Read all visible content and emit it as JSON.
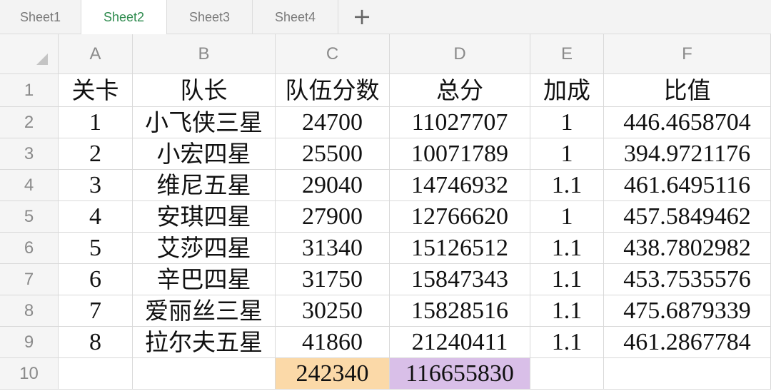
{
  "sheet_tabs": [
    {
      "label": "Sheet1",
      "active": false
    },
    {
      "label": "Sheet2",
      "active": true
    },
    {
      "label": "Sheet3",
      "active": false
    },
    {
      "label": "Sheet4",
      "active": false
    }
  ],
  "add_tab_label": "+",
  "colors": {
    "active_tab": "#2e8b4e",
    "total_team_score_fill": "#fbd9a8",
    "total_score_fill": "#d9bfe8"
  },
  "column_headers": [
    "A",
    "B",
    "C",
    "D",
    "E",
    "F"
  ],
  "row_headers": [
    "1",
    "2",
    "3",
    "4",
    "5",
    "6",
    "7",
    "8",
    "9",
    "10"
  ],
  "rows": [
    [
      "关卡",
      "队长",
      "队伍分数",
      "总分",
      "加成",
      "比值"
    ],
    [
      "1",
      "小飞侠三星",
      "24700",
      "11027707",
      "1",
      "446.4658704"
    ],
    [
      "2",
      "小宏四星",
      "25500",
      "10071789",
      "1",
      "394.9721176"
    ],
    [
      "3",
      "维尼五星",
      "29040",
      "14746932",
      "1.1",
      "461.6495116"
    ],
    [
      "4",
      "安琪四星",
      "27900",
      "12766620",
      "1",
      "457.5849462"
    ],
    [
      "5",
      "艾莎四星",
      "31340",
      "15126512",
      "1.1",
      "438.7802982"
    ],
    [
      "6",
      "辛巴四星",
      "31750",
      "15847343",
      "1.1",
      "453.7535576"
    ],
    [
      "7",
      "爱丽丝三星",
      "30250",
      "15828516",
      "1.1",
      "475.6879339"
    ],
    [
      "8",
      "拉尔夫五星",
      "41860",
      "21240411",
      "1.1",
      "461.2867784"
    ],
    [
      "",
      "",
      "242340",
      "116655830",
      "",
      ""
    ]
  ]
}
